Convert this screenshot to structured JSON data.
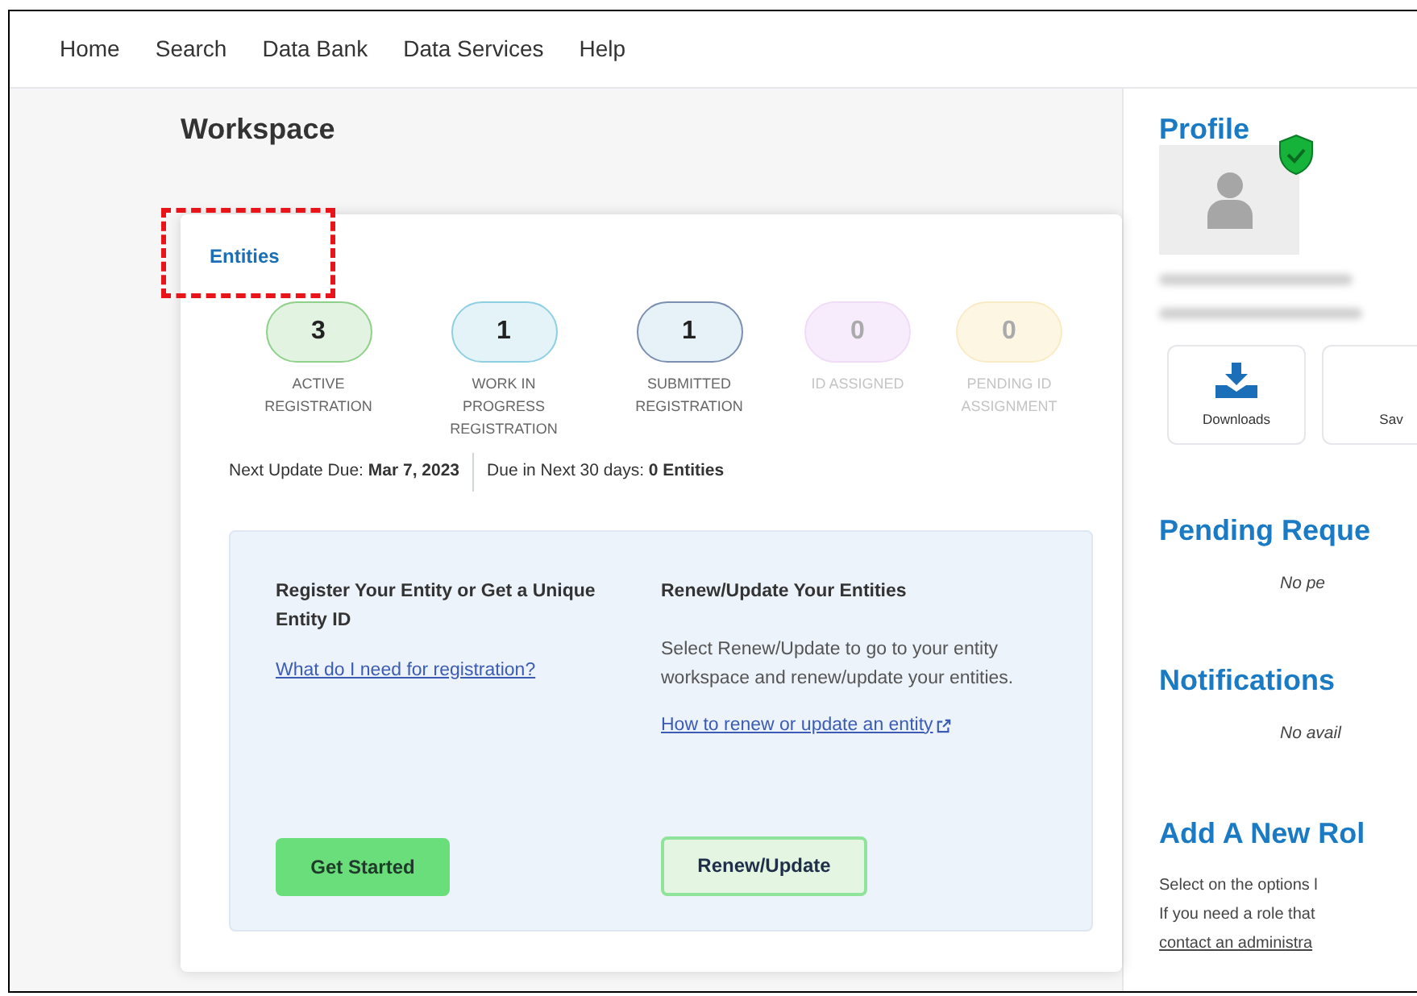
{
  "nav": [
    {
      "label": "Home"
    },
    {
      "label": "Search"
    },
    {
      "label": "Data Bank"
    },
    {
      "label": "Data Services"
    },
    {
      "label": "Help"
    }
  ],
  "workspace": {
    "title": "Workspace",
    "entities": {
      "tab": "Entities",
      "highlighted": true,
      "stats": [
        {
          "count": "3",
          "label": "ACTIVE REGISTRATION",
          "color": "#e3f3e1",
          "muted": false
        },
        {
          "count": "1",
          "label": "WORK IN PROGRESS REGISTRATION",
          "color": "#e4f3f8",
          "muted": false
        },
        {
          "count": "1",
          "label": "SUBMITTED REGISTRATION",
          "color": "#e6f2f8",
          "muted": false
        },
        {
          "count": "0",
          "label": "ID ASSIGNED",
          "color": "#f6ecfb",
          "muted": true
        },
        {
          "count": "0",
          "label": "PENDING ID ASSIGNMENT",
          "color": "#fdf6e3",
          "muted": true
        }
      ],
      "next_update": {
        "label": "Next Update Due:",
        "value": "Mar 7, 2023"
      },
      "due_next": {
        "label": "Due in Next 30 days:",
        "value": "0 Entities"
      },
      "panel": [
        {
          "heading": "Register Your Entity or Get a Unique Entity ID",
          "link": "What do I need for registration?",
          "external": false,
          "button": {
            "label": "Get Started",
            "kind": "primary"
          }
        },
        {
          "heading": "Renew/Update Your Entities",
          "text": "Select Renew/Update to go to your entity workspace and renew/update your entities.",
          "link": "How to renew or update an entity",
          "external": true,
          "button": {
            "label": "Renew/Update",
            "kind": "secondary"
          }
        }
      ]
    }
  },
  "profile": {
    "title": "Profile",
    "verified": true,
    "tiles": [
      {
        "label": "Downloads",
        "kind": "download"
      },
      {
        "label": "Sav",
        "kind": "plain"
      }
    ],
    "sections": [
      {
        "title": "Pending Reque",
        "text": "No pe"
      },
      {
        "title": "Notifications",
        "text": "No avail"
      }
    ],
    "add_role": {
      "title": "Add A New Rol",
      "lines": [
        "Select on the options l",
        "If you need a role that",
        "contact an administra"
      ]
    }
  }
}
